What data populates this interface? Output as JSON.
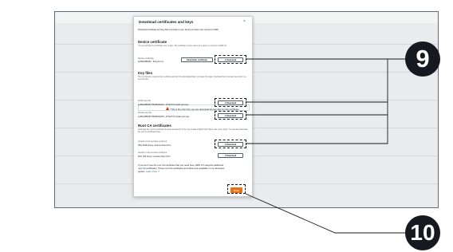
{
  "dialog": {
    "title": "Download certificates and keys",
    "close_glyph": "×",
    "intro": "Download certificate and key files to install on your device so that it can connect to AWS."
  },
  "device_certificate": {
    "heading": "Device certificate",
    "description": "You can activate the certificate now, or later. The certificate must be active for a device to connect to AWS IoT.",
    "label": "Device certificate",
    "file": "ee450d38bb87...5ca.pem.crt",
    "deactivate_label": "Deactivate certificate",
    "download_label": "Download"
  },
  "key_files": {
    "heading": "Key files",
    "description": "The key files are unique to this certificate and can't be downloaded after you leave this page. Download them now and save them in a secure place.",
    "warning": "This is the only time you can download the key files for this certificate.",
    "public_label": "Public key file",
    "public_file": "ee450d38bb8778b29b29e0f4...bb7a277d-public.pem.key",
    "private_label": "Private key file",
    "private_file": "ee450d38bb8778b29b29e0f4...bb7a277d-private.pem.key",
    "download_label": "Download"
  },
  "root_ca": {
    "heading": "Root CA certificates",
    "description": "Download the root CA certificate file that corresponds to the type of data endpoint and cipher suite you're using. You can also download the root CA certificates later.",
    "ca1_label": "Amazon trust services endpoint",
    "ca1_value": "RSA 2048 bit key: Amazon Root CA 1",
    "ca3_label": "Amazon trust services endpoint",
    "ca3_value": "ECC 256 bit key: Amazon Root CA 3",
    "download_label": "Download",
    "footer_note_1": "If you don't see the root CA certificate that you need here, AWS IoT supports additional",
    "footer_note_2": "root CA certificates. These root CA certificates and others are available in our developer",
    "footer_note_3": "guides.",
    "learn_more": "Learn more"
  },
  "done_label": "Done",
  "callouts": {
    "first": "9",
    "second": "10"
  },
  "icons": {
    "download": "download-icon",
    "warning": "warning-icon",
    "close": "close-icon",
    "external": "external-link-icon"
  },
  "colors": {
    "primary": "#ec7211",
    "warning": "#d13212",
    "link": "#0073bb"
  }
}
